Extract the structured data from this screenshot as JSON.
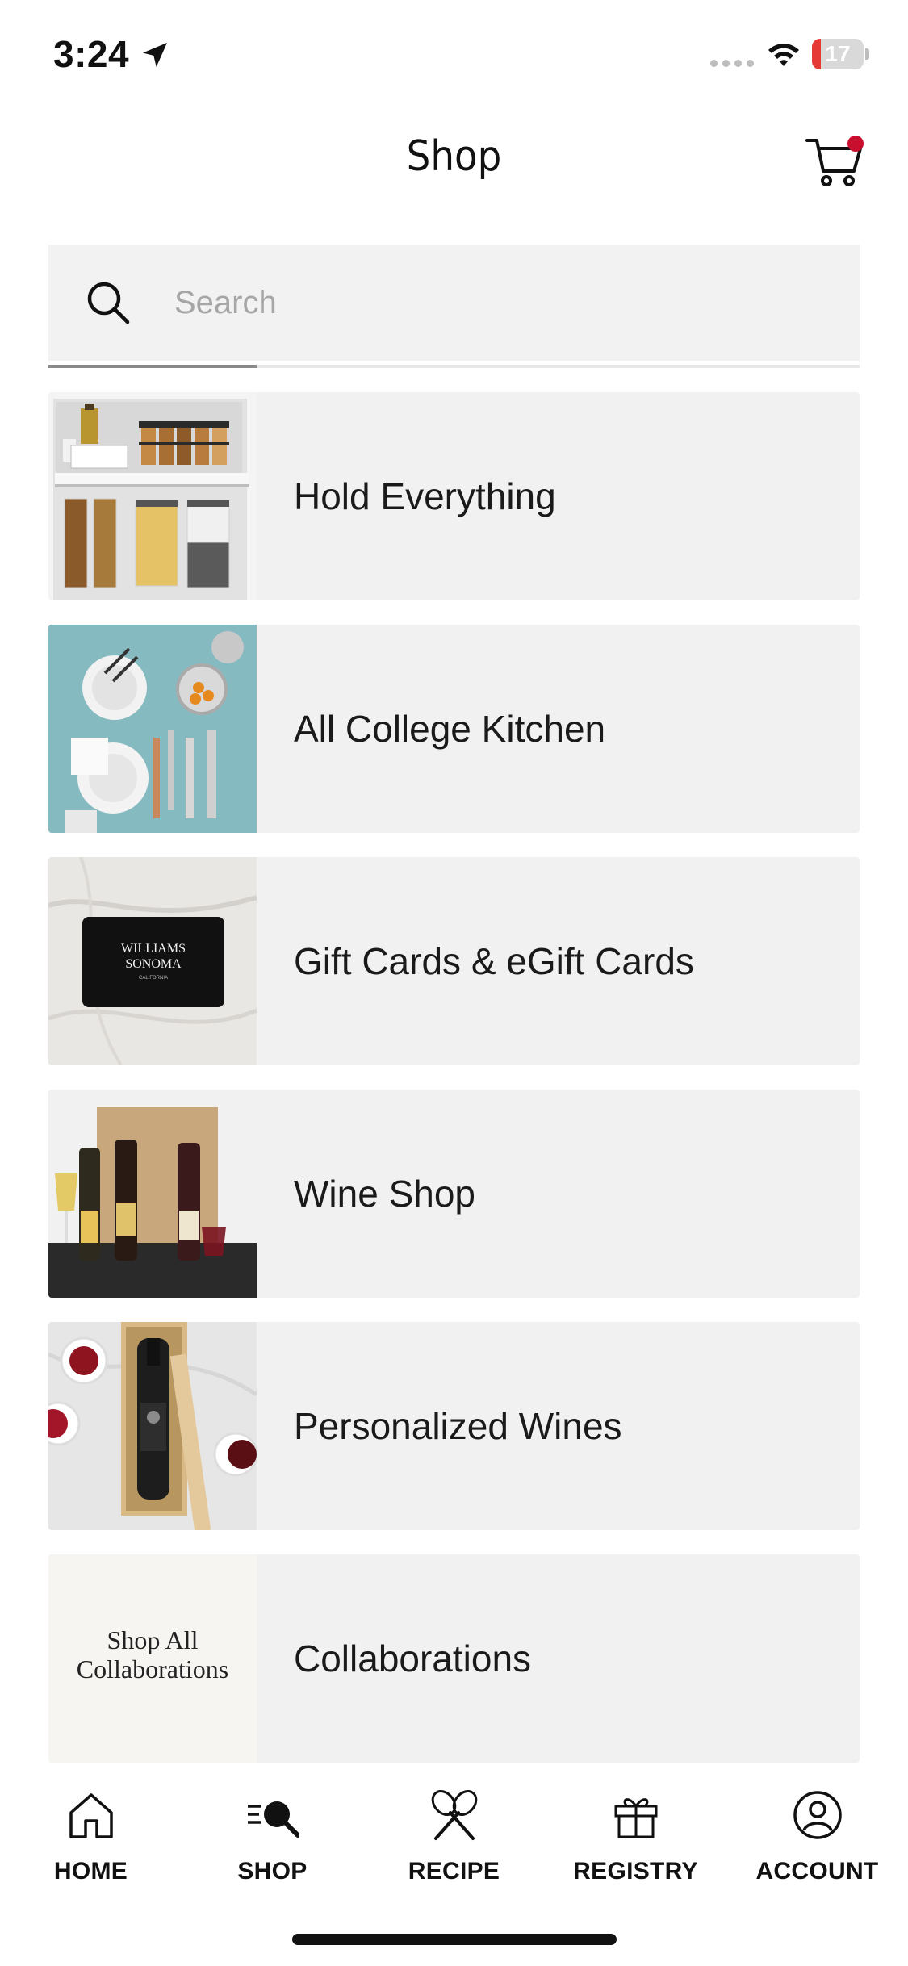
{
  "status_bar": {
    "time": "3:24",
    "battery_level": "17",
    "battery_fraction": 0.17,
    "battery_color": "#e53935"
  },
  "header": {
    "title": "Shop",
    "cart_badge_color": "#c8102e"
  },
  "search": {
    "placeholder": "Search",
    "value": ""
  },
  "categories": [
    {
      "label": "Hold Everything",
      "thumb": "pantry-shelves-image"
    },
    {
      "label": "All College Kitchen",
      "thumb": "dishes-utensils-image"
    },
    {
      "label": "Gift Cards & eGift Cards",
      "thumb": "gift-card-image",
      "card_text_1": "WILLIAMS",
      "card_text_2": "SONOMA",
      "card_text_3": "CALIFORNIA"
    },
    {
      "label": "Wine Shop",
      "thumb": "wine-bottles-image"
    },
    {
      "label": "Personalized Wines",
      "thumb": "personalized-wine-image"
    },
    {
      "label": "Collaborations",
      "thumb": "collaborations-image",
      "thumb_text": "Shop All Collaborations"
    }
  ],
  "tabs": [
    {
      "label": "HOME",
      "icon": "home-icon"
    },
    {
      "label": "SHOP",
      "icon": "shop-search-icon"
    },
    {
      "label": "RECIPE",
      "icon": "whisk-icon"
    },
    {
      "label": "REGISTRY",
      "icon": "gift-icon"
    },
    {
      "label": "ACCOUNT",
      "icon": "account-icon"
    }
  ]
}
